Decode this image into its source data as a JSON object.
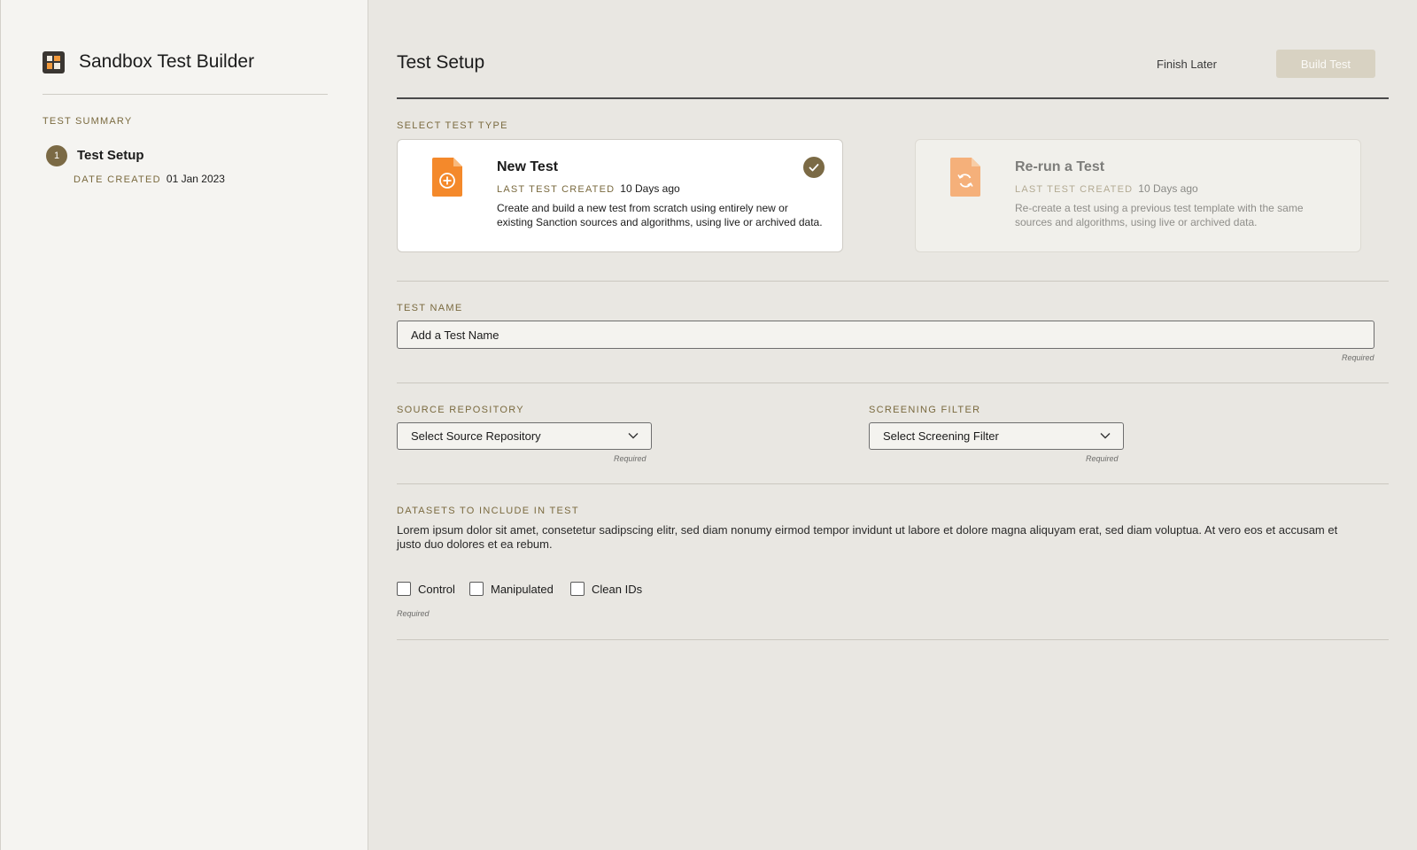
{
  "app": {
    "title": "Sandbox Test Builder"
  },
  "sidebar": {
    "summary_label": "TEST SUMMARY",
    "steps": [
      {
        "number": "1",
        "title": "Test Setup",
        "date_label": "DATE CREATED",
        "date_value": "01 Jan  2023"
      }
    ]
  },
  "header": {
    "title": "Test Setup",
    "finish_later": "Finish Later",
    "build_test": "Build Test"
  },
  "test_type": {
    "label": "SELECT TEST TYPE",
    "options": [
      {
        "title": "New Test",
        "meta_label": "LAST TEST CREATED",
        "meta_value": "10 Days ago",
        "description": "Create and build a new test from scratch using entirely new or existing Sanction sources and algorithms, using live or archived data.",
        "selected": true
      },
      {
        "title": "Re-run a Test",
        "meta_label": "LAST TEST CREATED",
        "meta_value": "10 Days ago",
        "description": "Re-create a test using a previous test template with the same sources and algorithms, using live or archived data.",
        "selected": false
      }
    ]
  },
  "test_name": {
    "label": "TEST NAME",
    "placeholder": "Add a Test Name",
    "required": "Required"
  },
  "source_repository": {
    "label": "SOURCE REPOSITORY",
    "value": "Select Source Repository",
    "required": "Required"
  },
  "screening_filter": {
    "label": "SCREENING FILTER",
    "value": "Select Screening Filter",
    "required": "Required"
  },
  "datasets": {
    "label": "DATASETS TO INCLUDE IN TEST",
    "description": "Lorem ipsum dolor sit amet, consetetur sadipscing elitr, sed diam nonumy eirmod tempor invidunt ut labore et dolore magna aliquyam erat, sed diam voluptua. At vero eos et accusam et justo duo dolores et ea rebum.",
    "options": [
      "Control",
      "Manipulated",
      "Clean IDs"
    ],
    "required": "Required"
  },
  "colors": {
    "accent": "#7b6a45",
    "label": "#7a6a3f",
    "file_icon": "#f4892b",
    "build_button": "#d8d2c2"
  },
  "icons": {
    "app": "grid-logo-icon",
    "new_test": "file-plus-icon",
    "rerun_test": "file-refresh-icon",
    "selected": "check-icon",
    "dropdown": "chevron-down-icon"
  }
}
